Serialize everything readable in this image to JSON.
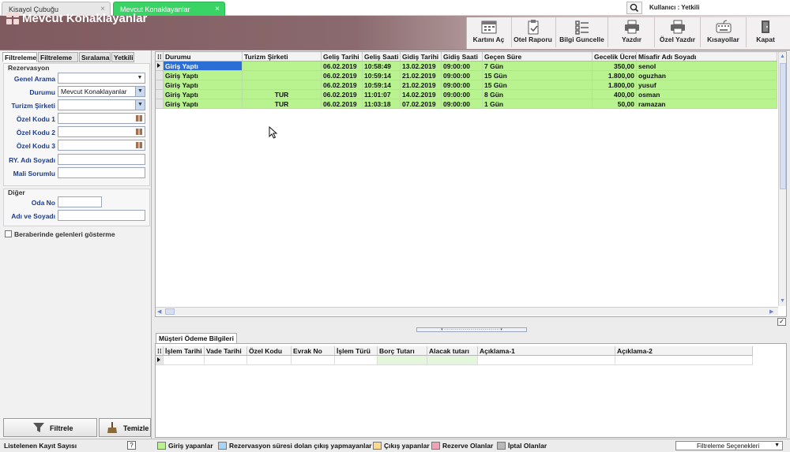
{
  "tabs": [
    {
      "label": "Kisayol Çubuğu",
      "close": "×"
    },
    {
      "label": "Mevcut Konaklayanlar",
      "close": "×"
    }
  ],
  "user": "Kullanıcı : Yetkili",
  "header": {
    "title": "Mevcut Konaklayanlar"
  },
  "toolbar": [
    {
      "label": "Kartını Aç",
      "icon": "calendar-icon"
    },
    {
      "label": "Otel Raporu",
      "icon": "clipboard-icon"
    },
    {
      "label": "Bilgi Guncelle",
      "icon": "checklist-icon"
    },
    {
      "label": "Yazdır",
      "icon": "printer-icon"
    },
    {
      "label": "Özel Yazdır",
      "icon": "printer-icon"
    },
    {
      "label": "Kısayollar",
      "icon": "keyboard-icon"
    },
    {
      "label": "Kapat",
      "icon": "exit-door-icon"
    }
  ],
  "filter_tabs": [
    "Filtreleme",
    "Filtreleme 2",
    "Sıralama",
    "Yetkili"
  ],
  "filters": {
    "reservation_group": "Rezervasyon",
    "genel_arama": {
      "label": "Genel Arama",
      "value": ""
    },
    "durumu": {
      "label": "Durumu",
      "value": "Mevcut Konaklayanlar"
    },
    "turizm_sirketi": {
      "label": "Turizm Şirketi",
      "value": ""
    },
    "ozel_kodu_1": {
      "label": "Özel Kodu 1",
      "value": ""
    },
    "ozel_kodu_2": {
      "label": "Özel Kodu 2",
      "value": ""
    },
    "ozel_kodu_3": {
      "label": "Özel Kodu 3",
      "value": ""
    },
    "ry_adi_soyadi": {
      "label": "RY. Adı Soyadı",
      "value": ""
    },
    "mali_sorumlu": {
      "label": "Mali Sorumlu",
      "value": ""
    },
    "other_group": "Diğer",
    "oda_no": {
      "label": "Oda No",
      "value": ""
    },
    "adi_ve_soyadi": {
      "label": "Adı ve Soyadı",
      "value": ""
    },
    "beraberinde": "Beraberinde gelenleri gösterme"
  },
  "buttons": {
    "filtrele": "Filtrele",
    "temizle": "Temizle"
  },
  "grid": {
    "headers": [
      "Durumu",
      "Turizm Şirketi",
      "Geliş Tarihi",
      "Geliş Saati",
      "Gidiş Tarihi",
      "Gidiş Saati",
      "Geçen Süre",
      "Gecelik Ücret",
      "Misafir Adı Soyadı"
    ],
    "rows": [
      [
        "Giriş Yaptı",
        "",
        "06.02.2019",
        "10:58:49",
        "13.02.2019",
        "09:00:00",
        "7 Gün",
        "350,00",
        "senol"
      ],
      [
        "Giriş Yaptı",
        "",
        "06.02.2019",
        "10:59:14",
        "21.02.2019",
        "09:00:00",
        "15 Gün",
        "1.800,00",
        "oguzhan"
      ],
      [
        "Giriş Yaptı",
        "",
        "06.02.2019",
        "10:59:14",
        "21.02.2019",
        "09:00:00",
        "15 Gün",
        "1.800,00",
        "yusuf"
      ],
      [
        "Giriş Yaptı",
        "TUR",
        "06.02.2019",
        "11:01:07",
        "14.02.2019",
        "09:00:00",
        "8 Gün",
        "400,00",
        "osman"
      ],
      [
        "Giriş Yaptı",
        "TUR",
        "06.02.2019",
        "11:03:18",
        "07.02.2019",
        "09:00:00",
        "1 Gün",
        "50,00",
        "ramazan"
      ]
    ]
  },
  "bottom": {
    "tab": "Müşteri Ödeme Bilgileri",
    "headers": [
      "İşlem Tarihi",
      "Vade Tarihi",
      "Özel Kodu",
      "Evrak No",
      "İşlem Türü",
      "Borç Tutarı",
      "Alacak tutarı",
      "Açıklama-1",
      "Açıklama-2"
    ]
  },
  "status": {
    "left": "Listelenen Kayıt Sayısı",
    "help": "?",
    "legend": [
      {
        "label": "Giriş yapanlar",
        "color": "#b9f390"
      },
      {
        "label": "Rezervasyon süresi dolan çıkış yapmayanlar",
        "color": "#a9d4f5"
      },
      {
        "label": "Çıkış yapanlar",
        "color": "#ffd98a"
      },
      {
        "label": "Rezerve Olanlar",
        "color": "#f4a0b8"
      },
      {
        "label": "İptal Olanlar",
        "color": "#b9b9b9"
      }
    ],
    "options": "Filtreleme Seçenekleri"
  }
}
